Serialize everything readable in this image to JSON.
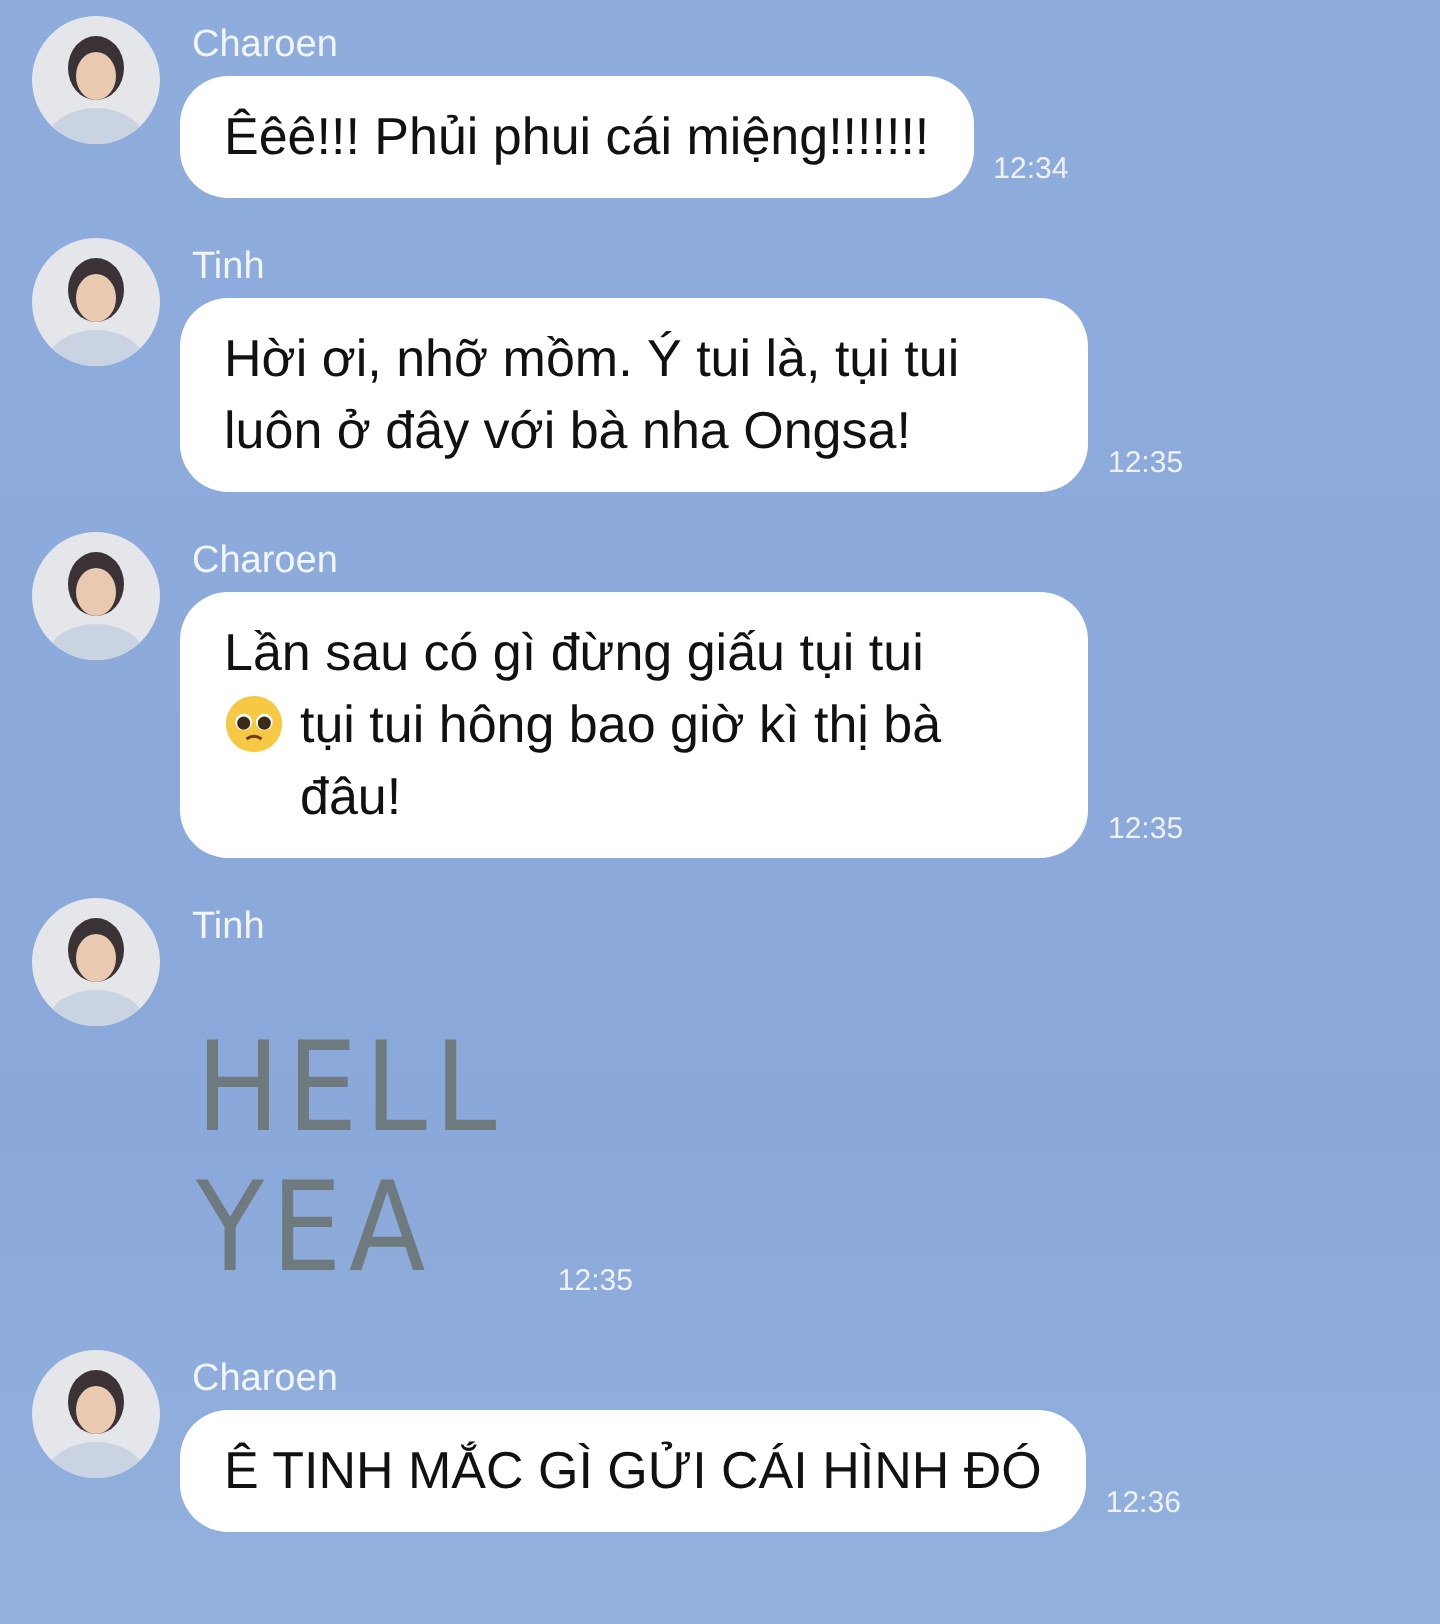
{
  "messages": [
    {
      "sender": "Charoen",
      "kind": "text",
      "parts": [
        {
          "kind": "text",
          "text": "Êêê!!! Phủi phui cái miệng!!!!!!!"
        }
      ],
      "time": "12:34"
    },
    {
      "sender": "Tinh",
      "kind": "text",
      "parts": [
        {
          "kind": "text",
          "text": "Hời ơi, nhỡ mồm. Ý tui là, tụi tui luôn ở đây với bà nha Ongsa!"
        }
      ],
      "time": "12:35"
    },
    {
      "sender": "Charoen",
      "kind": "text",
      "parts": [
        {
          "kind": "text",
          "text": "Lần sau có gì đừng giấu tụi tui"
        },
        {
          "kind": "emoji"
        },
        {
          "kind": "text",
          "text": "tụi tui hông bao giờ kì thị bà đâu!"
        }
      ],
      "time": "12:35"
    },
    {
      "sender": "Tinh",
      "kind": "sticker",
      "lines": [
        "HELL",
        "YEA"
      ],
      "time": "12:35"
    },
    {
      "sender": "Charoen",
      "kind": "text",
      "parts": [
        {
          "kind": "text",
          "text": "Ê TINH MẮC GÌ GỬI CÁI HÌNH ĐÓ"
        }
      ],
      "time": "12:36"
    }
  ]
}
